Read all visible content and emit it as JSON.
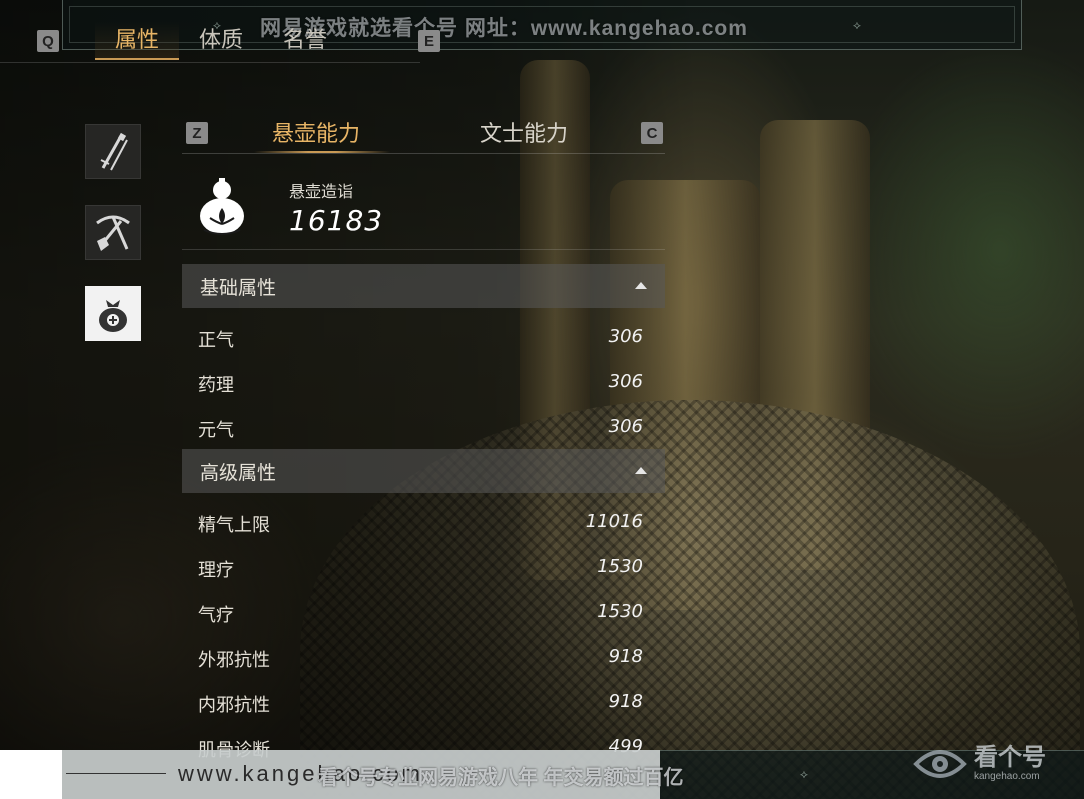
{
  "watermark": {
    "top_text": "网易游戏就选看个号   网址：www.kangehao.com",
    "bottom_url": "www.kangehao.com",
    "bottom_slogan": "看个号专业网易游戏八年 年交易额过百亿",
    "logo_text": "看个号",
    "logo_domain": "kangehao.com"
  },
  "keys": {
    "left": "Q",
    "right": "E",
    "sub_left": "Z",
    "sub_right": "C"
  },
  "main_tabs": [
    {
      "label": "属性",
      "active": true
    },
    {
      "label": "体质",
      "active": false
    },
    {
      "label": "名誉",
      "active": false
    }
  ],
  "side_icons": [
    {
      "name": "weapons-icon",
      "active": false
    },
    {
      "name": "tools-icon",
      "active": false
    },
    {
      "name": "medicine-bag-icon",
      "active": true
    }
  ],
  "sub_tabs": [
    {
      "label": "悬壶能力",
      "active": true
    },
    {
      "label": "文士能力",
      "active": false
    }
  ],
  "score": {
    "label": "悬壶造诣",
    "value": "16183",
    "icon": "gourd-icon"
  },
  "sections": {
    "basic": {
      "title": "基础属性",
      "rows": [
        {
          "label": "正气",
          "value": "306"
        },
        {
          "label": "药理",
          "value": "306"
        },
        {
          "label": "元气",
          "value": "306"
        }
      ]
    },
    "advanced": {
      "title": "高级属性",
      "rows": [
        {
          "label": "精气上限",
          "value": "11016"
        },
        {
          "label": "理疗",
          "value": "1530"
        },
        {
          "label": "气疗",
          "value": "1530"
        },
        {
          "label": "外邪抗性",
          "value": "918"
        },
        {
          "label": "内邪抗性",
          "value": "918"
        },
        {
          "label": "肌骨诊断",
          "value": "499"
        }
      ]
    }
  },
  "colors": {
    "accent": "#e8b566",
    "panel_header": "#5a5a5a"
  }
}
